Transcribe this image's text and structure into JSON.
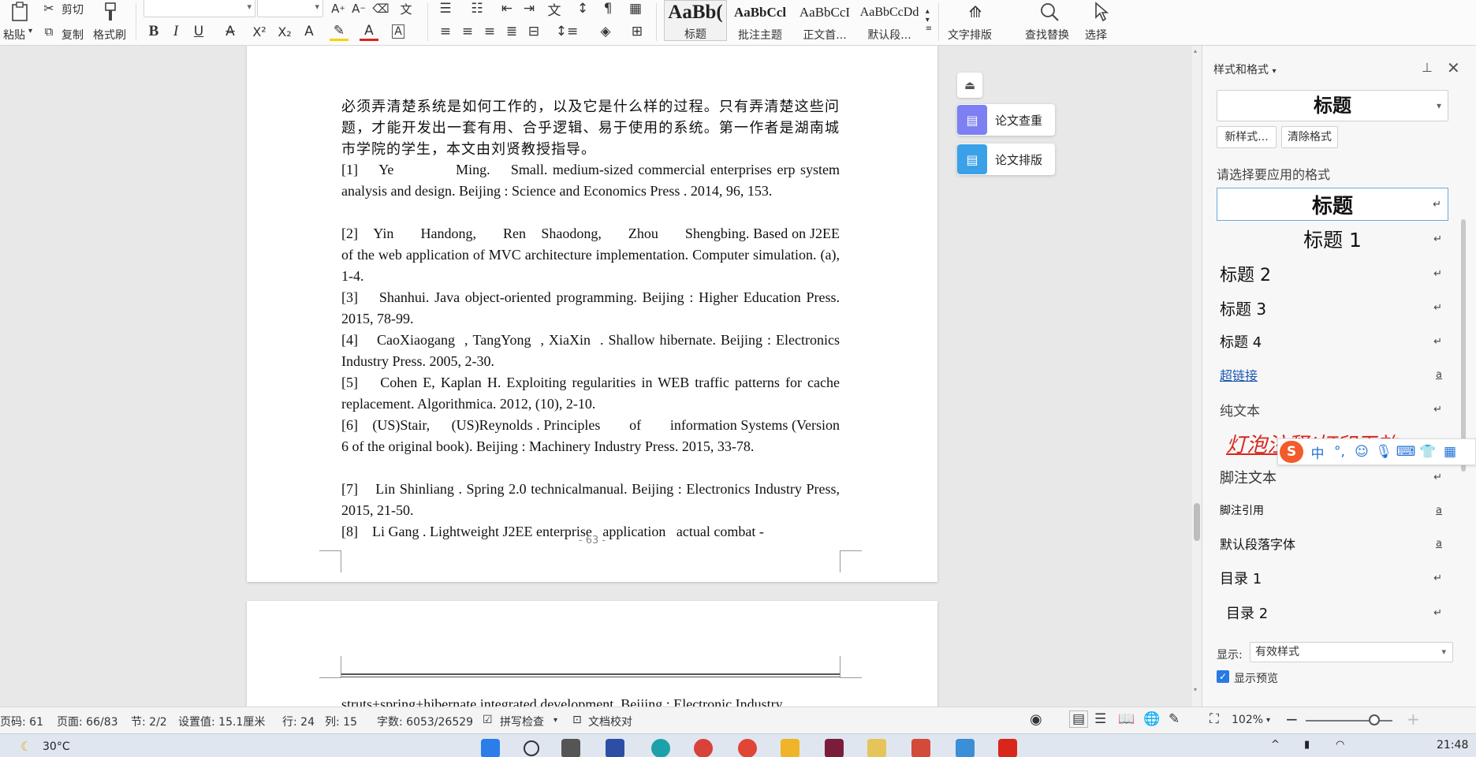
{
  "ribbon": {
    "paste": "粘贴",
    "cut": "剪切",
    "copy": "复制",
    "format_painter": "格式刷",
    "styles": [
      {
        "sample": "AaBb(",
        "name": "标题"
      },
      {
        "sample": "AaBbCcl",
        "name": "批注主题"
      },
      {
        "sample": "AaBbCcI",
        "name": "正文首..."
      },
      {
        "sample": "AaBbCcDd",
        "name": "默认段..."
      }
    ],
    "text_layout": "文字排版",
    "find_replace": "查找替换",
    "select": "选择"
  },
  "document": {
    "page1_paragraph": "必须弄清楚系统是如何工作的，以及它是什么样的过程。只有弄清楚这些问题，才能开发出一套有用、合乎逻辑、易于使用的系统。第一作者是湖南城市学院的学生，本文由刘贤教授指导。",
    "references": [
      "[1]    Ye            Ming.    Small. medium-sized commercial enterprises erp system analysis and design. Beijing : Science and Economics Press . 2014, 96, 153.",
      "[2]    Yin       Handong,       Ren    Shaodong,       Zhou       Shengbing. Based on J2EE of the web application of MVC architecture implementation. Computer simulation. (a), 1-4.",
      "[3]    Shanhui. Java object-oriented programming. Beijing : Higher Education Press. 2015, 78-99.",
      "[4]    CaoXiaogang  , TangYong  , XiaXin  . Shallow hibernate. Beijing : Electronics Industry Press. 2005, 2-30.",
      "[5]    Cohen E, Kaplan H. Exploiting regularities in WEB traffic patterns for cache replacement. Algorithmica. 2012, (10), 2-10.",
      "[6]    (US)Stair,      (US)Reynolds . Principles        of        information Systems (Version 6 of the original book). Beijing : Machinery Industry Press. 2015, 33-78.",
      "[7]    Lin Shinliang . Spring 2.0 technicalmanual. Beijing : Electronics Industry Press, 2015, 21-50.",
      "[8]    Li Gang . Lightweight J2EE enterprise   application   actual combat -"
    ],
    "page_number": "- 63 -",
    "page2_text": "struts+spring+hibernate integrated development. Beijing : Electronic Industry"
  },
  "float_buttons": {
    "check": "论文查重",
    "layout": "论文排版"
  },
  "panel": {
    "title": "样式和格式",
    "current_style": "标题",
    "new_style": "新样式...",
    "clear_format": "清除格式",
    "apply_label": "请选择要应用的格式",
    "styles": [
      {
        "name": "标题",
        "mark": "↵"
      },
      {
        "name": "标题  1",
        "mark": "↵"
      },
      {
        "name": "标题  2",
        "mark": "↵"
      },
      {
        "name": "标题  3",
        "mark": "↵"
      },
      {
        "name": "标题  4",
        "mark": "↵"
      },
      {
        "name": "超链接",
        "mark": "a"
      },
      {
        "name": "纯文本",
        "mark": "↵"
      },
      {
        "name": "灯泡注释/打印无效",
        "mark": "↵"
      },
      {
        "name": "脚注文本",
        "mark": "↵"
      },
      {
        "name": "脚注引用",
        "mark": "a"
      },
      {
        "name": "默认段落字体",
        "mark": "a"
      },
      {
        "name": "目录  1",
        "mark": "↵"
      },
      {
        "name": "目录  2",
        "mark": "↵"
      }
    ],
    "show_label": "显示:",
    "show_value": "有效样式",
    "preview_label": "显示预览"
  },
  "ime": {
    "mode": "中",
    "punct": "°,"
  },
  "status": {
    "page_code": "页码: 61",
    "page": "页面: 66/83",
    "section": "节: 2/2",
    "setting": "设置值: 15.1厘米",
    "row": "行: 24",
    "col": "列: 15",
    "word_count": "字数: 6053/26529",
    "spell_check": "拼写检查",
    "doc_check": "文档校对",
    "zoom": "102%"
  },
  "taskbar": {
    "temperature": "30°C",
    "time": "21:48"
  },
  "colors": {
    "accent": "#2a7ae2",
    "hyperlink": "#1a56b0",
    "wps_red": "#d9261c",
    "spell_underline": "#d33333"
  }
}
